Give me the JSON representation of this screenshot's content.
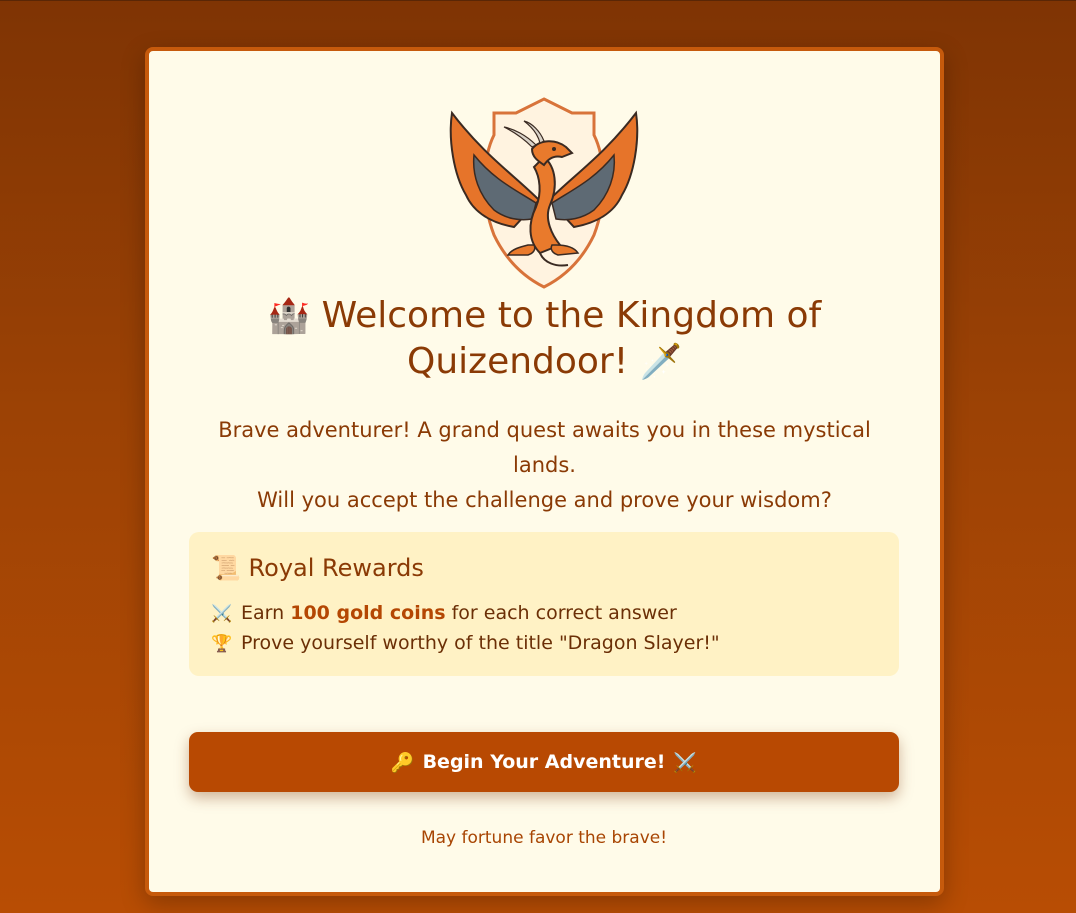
{
  "title": {
    "icon_left": "🏰",
    "text": "Welcome to the Kingdom of Quizendoor!",
    "icon_right": "🗡️"
  },
  "intro": {
    "line1": "Brave adventurer! A grand quest awaits you in these mystical lands.",
    "line2": "Will you accept the challenge and prove your wisdom?"
  },
  "rewards": {
    "icon": "📜",
    "title": "Royal Rewards",
    "items": [
      {
        "icon": "⚔️",
        "pre": "Earn",
        "bold": "100 gold coins",
        "post": "for each correct answer"
      },
      {
        "icon": "🏆",
        "text": "Prove yourself worthy of the title \"Dragon Slayer!\""
      }
    ]
  },
  "cta": {
    "icon_left": "🔑",
    "label": "Begin Your Adventure!",
    "icon_right": "⚔️"
  },
  "footer": "May fortune favor the brave!",
  "colors": {
    "accent": "#b84902",
    "card_bg": "#fffbe9",
    "rewards_bg": "#fff2c5",
    "text": "#8a3a05"
  },
  "emblem": {
    "icon": "dragon-shield-logo"
  }
}
